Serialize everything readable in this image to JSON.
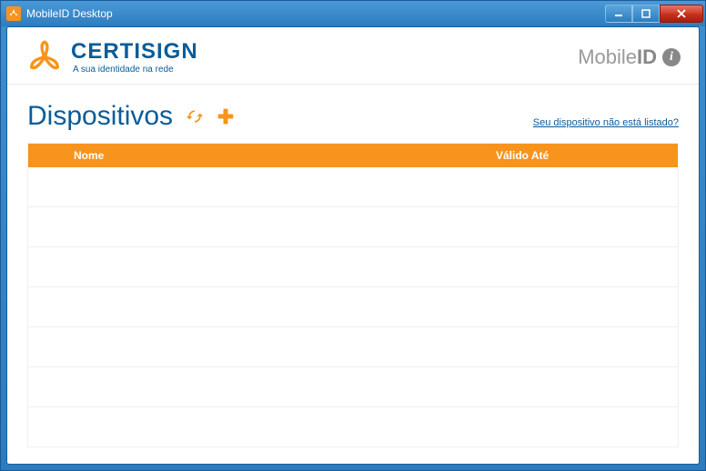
{
  "window": {
    "title": "MobileID Desktop"
  },
  "logo": {
    "name": "CERTISIGN",
    "tagline": "A sua identidade na rede"
  },
  "brand": {
    "mobile": "Mobile",
    "id": "ID"
  },
  "page": {
    "title": "Dispositivos",
    "help_link": "Seu dispositivo não está listado?"
  },
  "table": {
    "columns": {
      "name": "Nome",
      "valid_until": "Válido Até"
    },
    "rows": []
  },
  "colors": {
    "accent": "#f7941d",
    "primary": "#0a5c99"
  }
}
